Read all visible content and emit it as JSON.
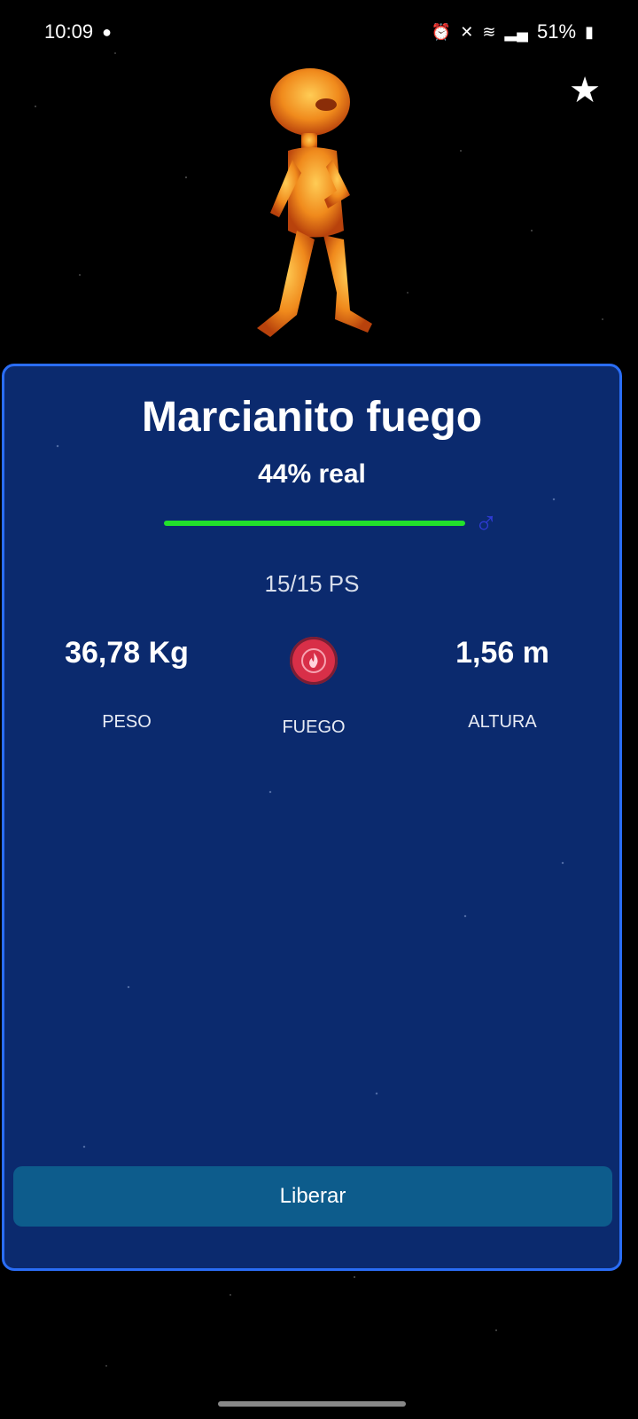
{
  "status_bar": {
    "time": "10:09",
    "battery": "51%"
  },
  "creature": {
    "name": "Marcianito fuego",
    "real_percent_label": "44% real",
    "hp_text": "15/15 PS",
    "hp_fraction": 1.0,
    "gender": "male",
    "gender_symbol": "♂"
  },
  "stats": {
    "weight_value": "36,78 Kg",
    "weight_label": "PESO",
    "type_label": "FUEGO",
    "height_value": "1,56 m",
    "height_label": "ALTURA"
  },
  "actions": {
    "release_label": "Liberar"
  },
  "icons": {
    "favorite": "star-icon",
    "type": "fire-icon"
  },
  "colors": {
    "card_bg": "#0b2a6e",
    "card_border": "#2a6df5",
    "hp_bar": "#22e12b",
    "gender": "#2f3bd6",
    "type_badge": "#d82f48",
    "button_bg": "#0d5c8c"
  }
}
